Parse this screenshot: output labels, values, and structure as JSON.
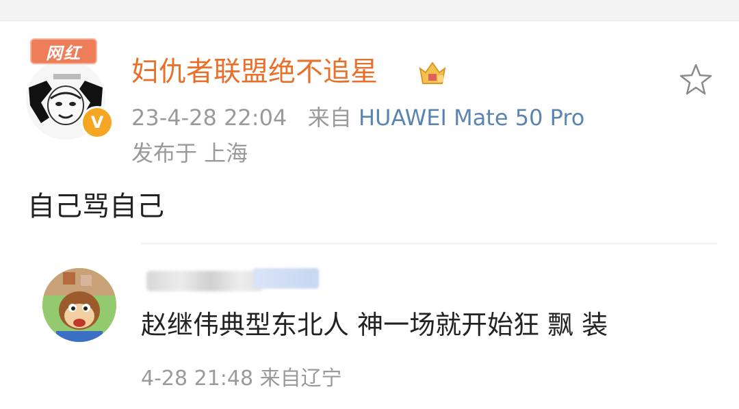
{
  "post": {
    "badge_label": "网红",
    "username": "妇仇者联盟绝不追星",
    "time": "23-4-28 22:04",
    "from_label": "来自",
    "device": "HUAWEI Mate 50 Pro",
    "location": "发布于 上海",
    "text": "自己骂自己"
  },
  "comment": {
    "text": "赵继伟典型东北人 神一场就开始狂 飘 装",
    "meta": "4-28 21:48 来自辽宁"
  },
  "colors": {
    "username": "#e8702a",
    "device": "#5b84b1",
    "meta": "#9a9a9a"
  },
  "icons": [
    "vip-crown-icon",
    "favorite-star-icon",
    "verified-v-icon"
  ]
}
